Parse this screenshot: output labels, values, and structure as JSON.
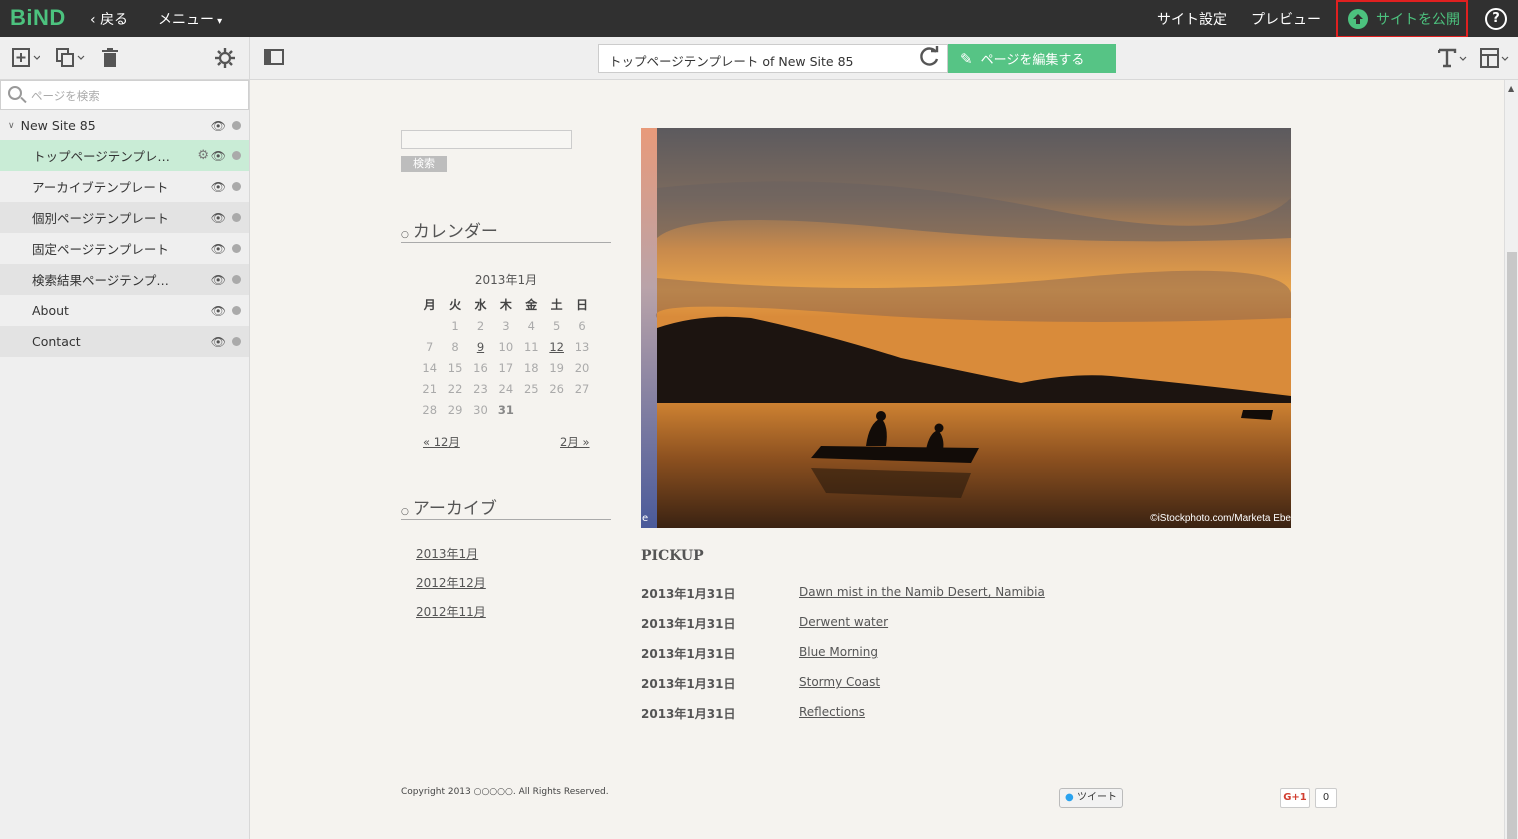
{
  "topbar": {
    "logo": "BiND",
    "back_label": "戻る",
    "menu_label": "メニュー",
    "site_settings_label": "サイト設定",
    "preview_label": "プレビュー",
    "publish_label": "サイトを公開",
    "help_label": "?"
  },
  "toolbar": {
    "url_text": "トップページテンプレート of New Site 85",
    "edit_label": "ページを編集する"
  },
  "sidebar": {
    "search_placeholder": "ページを検索",
    "site_name": "New Site 85",
    "pages": [
      {
        "label": "トップページテンプレ…",
        "selected": true
      },
      {
        "label": "アーカイブテンプレート"
      },
      {
        "label": "個別ページテンプレート"
      },
      {
        "label": "固定ページテンプレート"
      },
      {
        "label": "検索結果ページテンプ…"
      },
      {
        "label": "About"
      },
      {
        "label": "Contact"
      }
    ]
  },
  "page": {
    "search_button": "検索",
    "calendar_heading": "カレンダー",
    "calendar_month": "2013年1月",
    "weekdays": [
      "月",
      "火",
      "水",
      "木",
      "金",
      "土",
      "日"
    ],
    "weeks": [
      [
        "",
        "1",
        "2",
        "3",
        "4",
        "5",
        "6"
      ],
      [
        "7",
        "8",
        "9",
        "10",
        "11",
        "12",
        "13"
      ],
      [
        "14",
        "15",
        "16",
        "17",
        "18",
        "19",
        "20"
      ],
      [
        "21",
        "22",
        "23",
        "24",
        "25",
        "26",
        "27"
      ],
      [
        "28",
        "29",
        "30",
        "31",
        "",
        "",
        ""
      ]
    ],
    "prev_month": "« 12月",
    "next_month": "2月 »",
    "archive_heading": "アーカイブ",
    "archives": [
      "2013年1月",
      "2012年12月",
      "2012年11月"
    ],
    "hero_credit": "©iStockphoto.com/Marketa Ebe",
    "hero_strip_text": "e",
    "pickup_heading": "PICKUP",
    "pickup": [
      {
        "date": "2013年1月31日",
        "title": "Dawn mist in the Namib Desert, Namibia"
      },
      {
        "date": "2013年1月31日",
        "title": "Derwent water"
      },
      {
        "date": "2013年1月31日",
        "title": "Blue Morning"
      },
      {
        "date": "2013年1月31日",
        "title": "Stormy Coast"
      },
      {
        "date": "2013年1月31日",
        "title": "Reflections"
      }
    ],
    "copyright": "Copyright 2013 ○○○○○. All Rights Reserved.",
    "tweet_label": "ツイート",
    "gplus_label": "G+1",
    "gplus_count": "0"
  },
  "colors": {
    "accent_green": "#4cc27e",
    "publish_border": "#e02020",
    "selected_row": "#c9ecd6"
  }
}
